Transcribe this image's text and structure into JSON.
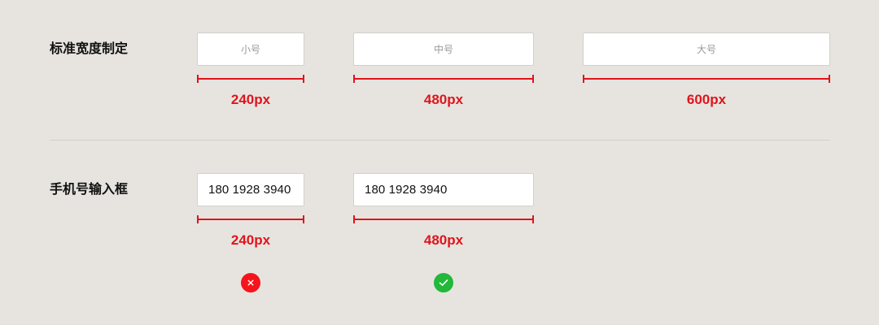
{
  "section1": {
    "label": "标准宽度制定",
    "fields": [
      {
        "placeholder": "小号",
        "width_label": "240px"
      },
      {
        "placeholder": "中号",
        "width_label": "480px"
      },
      {
        "placeholder": "大号",
        "width_label": "600px"
      }
    ]
  },
  "section2": {
    "label": "手机号输入框",
    "fields": [
      {
        "value": "180 1928 3940",
        "width_label": "240px",
        "status": "incorrect"
      },
      {
        "value": "180 1928 3940",
        "width_label": "480px",
        "status": "correct"
      }
    ]
  },
  "icons": {
    "incorrect": "close-icon",
    "correct": "check-icon"
  },
  "colors": {
    "measure": "#e0141b",
    "incorrect": "#f5141b",
    "correct": "#22b83a",
    "background": "#e7e4e0"
  }
}
